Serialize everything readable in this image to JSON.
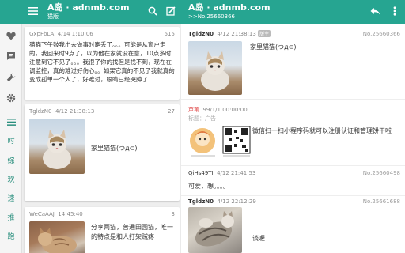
{
  "left_appbar": {
    "title": "A岛 · adnmb.com",
    "subtitle": "猫版"
  },
  "right_appbar": {
    "title": "A岛 · adnmb.com",
    "subtitle": ">>No.25660366"
  },
  "sidenav": {
    "items": [
      "时",
      "综",
      "欢",
      "速",
      "推",
      "跑"
    ]
  },
  "threads": [
    {
      "user": "GxpFbLA",
      "time": "4/14 1:10:06",
      "count": "515",
      "text": "猫猫下午鼓我出去做事时跑丢了。。。可能是从窗户走的，我回来时9点了，以为他在家就没在意，10点多时注意到它不见了。。。我很了你的找但是找不到，现在在调监控，真的难过好伤心。。如果它真的不见了我就真的变成孤单一个人了，好难过，眼睛已经哭肿了"
    },
    {
      "user": "TgldzN0",
      "time": "4/12 21:38:13",
      "count": "27",
      "text": "家里猫猫(つд⊂)"
    },
    {
      "user": "WeCaAAJ",
      "time": "14:45:40",
      "count": "3",
      "text": "分享两猫，普通田园猫，唯一的特点是和人打架贼疼"
    }
  ],
  "posts": [
    {
      "user": "TgldzN0",
      "time": "4/12 21:38:13",
      "badge": "版主",
      "no": "No.25660366",
      "text": "家里猫猫(つд⊂)"
    },
    {
      "user": "芦苇",
      "time": "99/1/1 00:00:00",
      "title": "标题：广告",
      "no": "",
      "text": "微信扫一扫小程序码就可以注册认证和管理饼干啦"
    },
    {
      "user": "QiHs49TI",
      "time": "4/12 21:41:53",
      "no": "No.25660498",
      "text": "可爱，想。。。。"
    },
    {
      "user": "TgldzN0",
      "time": "4/12 22:12:29",
      "no": "No.25661688",
      "text": "谈喔"
    }
  ],
  "colors": {
    "primary": "#26a591",
    "status": "#1f8a78",
    "ad_user": "#e25353"
  }
}
